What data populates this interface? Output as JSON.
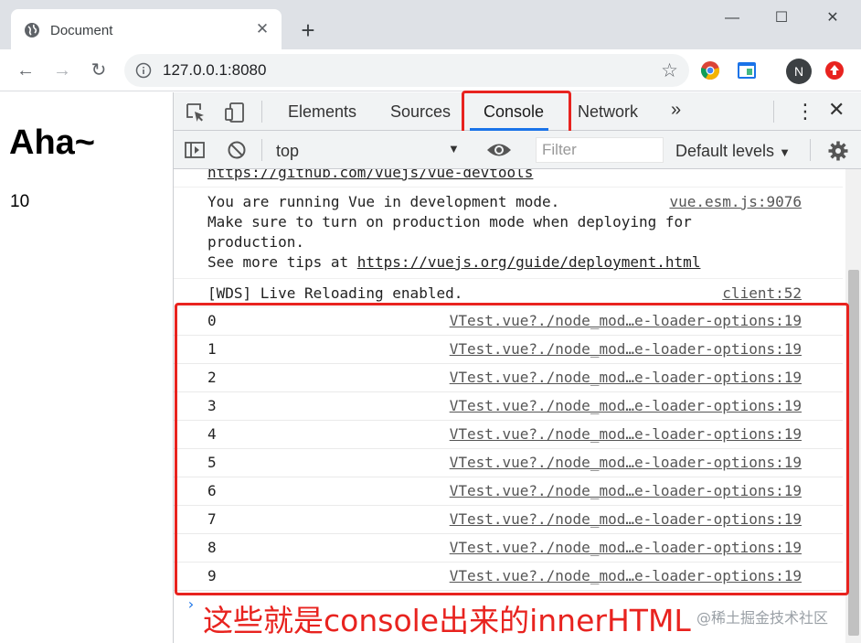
{
  "browser": {
    "tab_title": "Document",
    "url": "127.0.0.1:8080",
    "avatar_letter": "N"
  },
  "page": {
    "heading": "Aha~",
    "value": "10"
  },
  "devtools": {
    "tabs": [
      "Elements",
      "Sources",
      "Console",
      "Network"
    ],
    "active_tab": "Console",
    "context": "top",
    "filter_placeholder": "Filter",
    "levels": "Default levels"
  },
  "console": {
    "devtools_link": "https://github.com/vuejs/vue-devtools",
    "vue_lines": [
      "You are running Vue in development mode.",
      "Make sure to turn on production mode when deploying for",
      "production.",
      "See more tips at "
    ],
    "vue_link": "https://vuejs.org/guide/deployment.html",
    "vue_source": "vue.esm.js:9076",
    "wds_text": "[WDS] Live Reloading enabled.",
    "wds_source": "client:52",
    "log_source": "VTest.vue?./node_mod…e-loader-options:19",
    "logs": [
      "0",
      "1",
      "2",
      "3",
      "4",
      "5",
      "6",
      "7",
      "8",
      "9"
    ]
  },
  "annotation": "这些就是console出来的innerHTML",
  "watermark": "@稀土掘金技术社区",
  "colors": {
    "highlight": "#e8231f",
    "active_tab_underline": "#1a73e8"
  }
}
